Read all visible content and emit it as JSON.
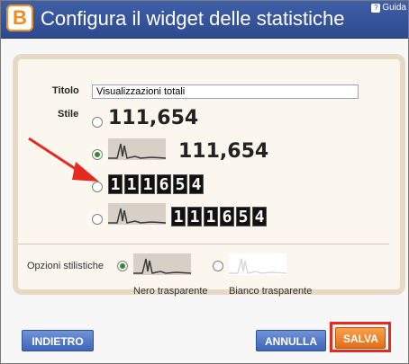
{
  "window": {
    "title": "Configura il widget delle statistiche",
    "help_label": "Guida",
    "logo_letter": "B"
  },
  "form": {
    "title_label": "Titolo",
    "title_value": "Visualizzazioni totali",
    "style_label": "Stile",
    "style_options": [
      {
        "label": "111,654",
        "selected": false
      },
      {
        "label": "111,654",
        "selected": true
      },
      {
        "digits": [
          "1",
          "1",
          "1",
          "6",
          "5",
          "4"
        ],
        "selected": false
      },
      {
        "digits": [
          "1",
          "1",
          "1",
          "6",
          "5",
          "4"
        ],
        "selected": false
      }
    ],
    "style_options_label": "Opzioni stilistiche",
    "style_choices": [
      {
        "label": "Nero trasparente",
        "selected": true
      },
      {
        "label": "Bianco trasparente",
        "selected": false
      }
    ]
  },
  "buttons": {
    "back": "INDIETRO",
    "cancel": "ANNULLA",
    "save": "SALVA"
  },
  "colors": {
    "header": "#2d4a8f",
    "highlight": "#e52a1f",
    "arrow": "#e52a1f"
  }
}
